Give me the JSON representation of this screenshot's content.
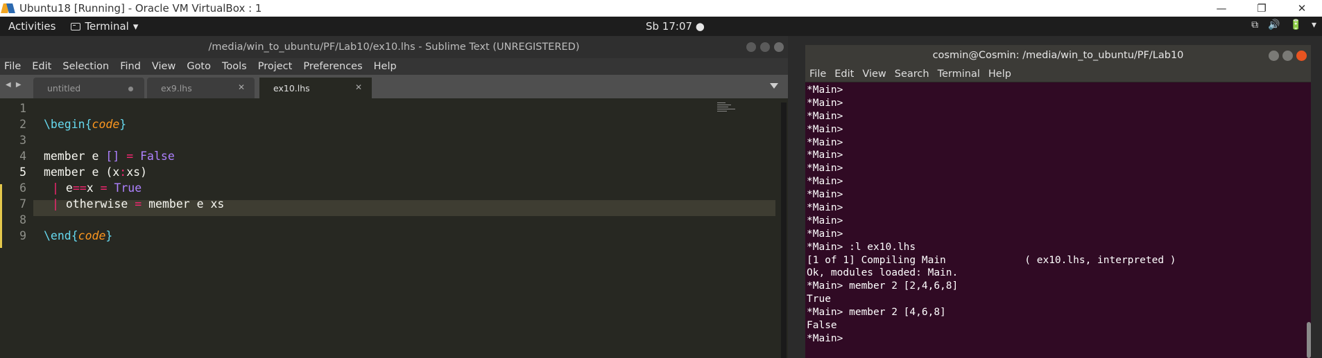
{
  "host": {
    "title": "Ubuntu18 [Running] - Oracle VM VirtualBox : 1",
    "minimize": "—",
    "restore": "❐",
    "close": "✕"
  },
  "topbar": {
    "activities": "Activities",
    "app": "Terminal",
    "app_arrow": "▾",
    "clock": "Sb 17:07 ●",
    "tray": [
      "⧉",
      "🔊",
      "🔋",
      "▾"
    ]
  },
  "sublime": {
    "title": "/media/win_to_ubuntu/PF/Lab10/ex10.lhs - Sublime Text (UNREGISTERED)",
    "menu": [
      "File",
      "Edit",
      "Selection",
      "Find",
      "View",
      "Goto",
      "Tools",
      "Project",
      "Preferences",
      "Help"
    ],
    "tab_nav": "◀ ▶",
    "tabs": [
      {
        "label": "untitled",
        "close": ""
      },
      {
        "label": "ex9.lhs",
        "close": "✕"
      },
      {
        "label": "ex10.lhs",
        "close": "✕"
      }
    ],
    "line_numbers": [
      "1",
      "2",
      "3",
      "4",
      "5",
      "6",
      "7",
      "8",
      "9"
    ],
    "code": {
      "l2_pre": "\\begin{",
      "l2_word": "code",
      "l2_post": "}",
      "l4_a": "member e ",
      "l4_b": "[]",
      "l4_c": " ",
      "l4_d": "=",
      "l4_e": " ",
      "l4_f": "False",
      "l5_a": "member e (x",
      "l5_b": ":",
      "l5_c": "xs)",
      "l6_bar": "|",
      "l6_a": " e",
      "l6_b": "==",
      "l6_c": "x ",
      "l6_d": "=",
      "l6_e": " ",
      "l6_f": "True",
      "l7_bar": "|",
      "l7_a": " otherwise ",
      "l7_b": "=",
      "l7_c": " member e xs",
      "l9_pre": "\\end{",
      "l9_word": "code",
      "l9_post": "}"
    }
  },
  "terminal": {
    "title": "cosmin@Cosmin: /media/win_to_ubuntu/PF/Lab10",
    "menu": [
      "File",
      "Edit",
      "View",
      "Search",
      "Terminal",
      "Help"
    ],
    "lines": [
      "*Main>",
      "*Main>",
      "*Main>",
      "*Main>",
      "*Main>",
      "*Main>",
      "*Main>",
      "*Main>",
      "*Main>",
      "*Main>",
      "*Main>",
      "*Main>",
      "*Main> :l ex10.lhs",
      "[1 of 1] Compiling Main             ( ex10.lhs, interpreted )",
      "Ok, modules loaded: Main.",
      "*Main> member 2 [2,4,6,8]",
      "True",
      "*Main> member 2 [4,6,8]",
      "False",
      "*Main>"
    ]
  },
  "colors": {
    "editor_bg": "#272822",
    "terminal_bg": "#300a24",
    "ubuntu_orange": "#e95420"
  }
}
